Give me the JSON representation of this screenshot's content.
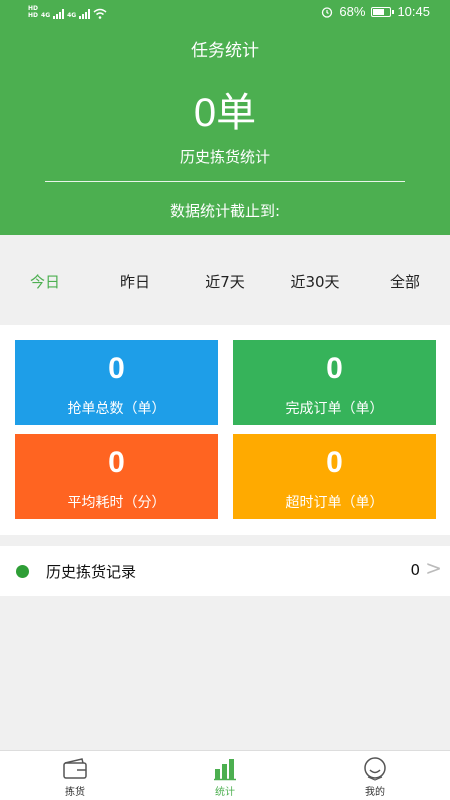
{
  "status_bar": {
    "hd_top": "HD",
    "hd_bottom": "HD",
    "net1": "4G",
    "net2": "4G",
    "battery_percent": "68%",
    "battery_level": 0.68,
    "time": "10:45"
  },
  "header": {
    "title": "任务统计",
    "count": "0单",
    "subtitle": "历史拣货统计",
    "cutoff_label": "数据统计截止到:"
  },
  "tabs": [
    {
      "label": "今日",
      "active": true
    },
    {
      "label": "昨日",
      "active": false
    },
    {
      "label": "近7天",
      "active": false
    },
    {
      "label": "近30天",
      "active": false
    },
    {
      "label": "全部",
      "active": false
    }
  ],
  "cards": [
    {
      "value": "0",
      "label": "抢单总数（单）",
      "color": "#1e9ee8"
    },
    {
      "value": "0",
      "label": "完成订单（单）",
      "color": "#36b35a"
    },
    {
      "value": "0",
      "label": "平均耗时（分）",
      "color": "#ff6421"
    },
    {
      "value": "0",
      "label": "超时订单（单）",
      "color": "#ffaa00"
    }
  ],
  "record": {
    "label": "历史拣货记录",
    "count": "0",
    "chevron": ">"
  },
  "bottom_nav": [
    {
      "label": "拣货",
      "icon": "wallet-icon",
      "active": false
    },
    {
      "label": "统计",
      "icon": "bar-chart-icon",
      "active": true
    },
    {
      "label": "我的",
      "icon": "user-face-icon",
      "active": false
    }
  ],
  "colors": {
    "accent": "#4caf50",
    "header_bg": "#4caf50"
  }
}
